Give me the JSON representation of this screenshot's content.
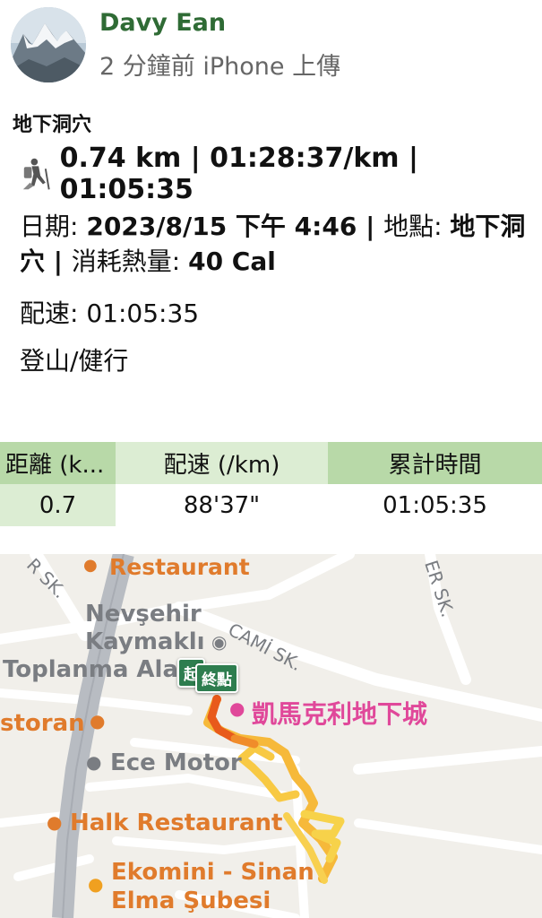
{
  "post": {
    "author": "Davy Ean",
    "meta": "2 分鐘前 iPhone 上傳",
    "title": "地下洞穴",
    "summary_stats": "0.74 km | 01:28:37/km | 01:05:35",
    "date_label": "日期: ",
    "date_value": "2023/8/15 下午 4:46",
    "sep1": " | ",
    "location_label": "地點: ",
    "location_value": "地下洞穴",
    "sep2": " | ",
    "calorie_label": "消耗熱量: ",
    "calorie_value": "40 Cal",
    "pace_line": "配速: 01:05:35",
    "category": "登山/健行"
  },
  "table": {
    "headers": [
      "距離 (k...",
      "配速 (/km)",
      "累計時間"
    ],
    "rows": [
      [
        "0.7",
        "88'37\"",
        "01:05:35"
      ]
    ]
  },
  "map": {
    "labels": {
      "restaurant_top": "Restaurant",
      "nevsehir": "Nevşehir",
      "kaymakli": "Kaymaklı",
      "toplanma": "Toplanma Ala",
      "storan": "storan",
      "ece_motor": "Ece Motor",
      "halk": "Halk Restaurant",
      "ekomini": "Ekomini - Sinan",
      "elma": "Elma Şubesi",
      "kaymakli_city": "凱馬克利地下城",
      "cami": "CAMİ SK.",
      "er_sk": "ER SK.",
      "r_sk": "R SK."
    },
    "start_pin": "起",
    "end_pin": "終點"
  },
  "colors": {
    "author": "#2f6b35",
    "table_header": "#b8d9a8",
    "table_light": "#dcedd3",
    "poi_orange": "#e07b2c",
    "poi_pink": "#e0489a",
    "pin_green": "#2e7d4f"
  },
  "icons": {
    "avatar": "mountain-photo",
    "activity": "hiker-icon",
    "poi_food": "fork-knife-icon",
    "poi_landmark": "museum-icon",
    "poi_shop": "cart-icon",
    "poi_car": "car-icon"
  }
}
